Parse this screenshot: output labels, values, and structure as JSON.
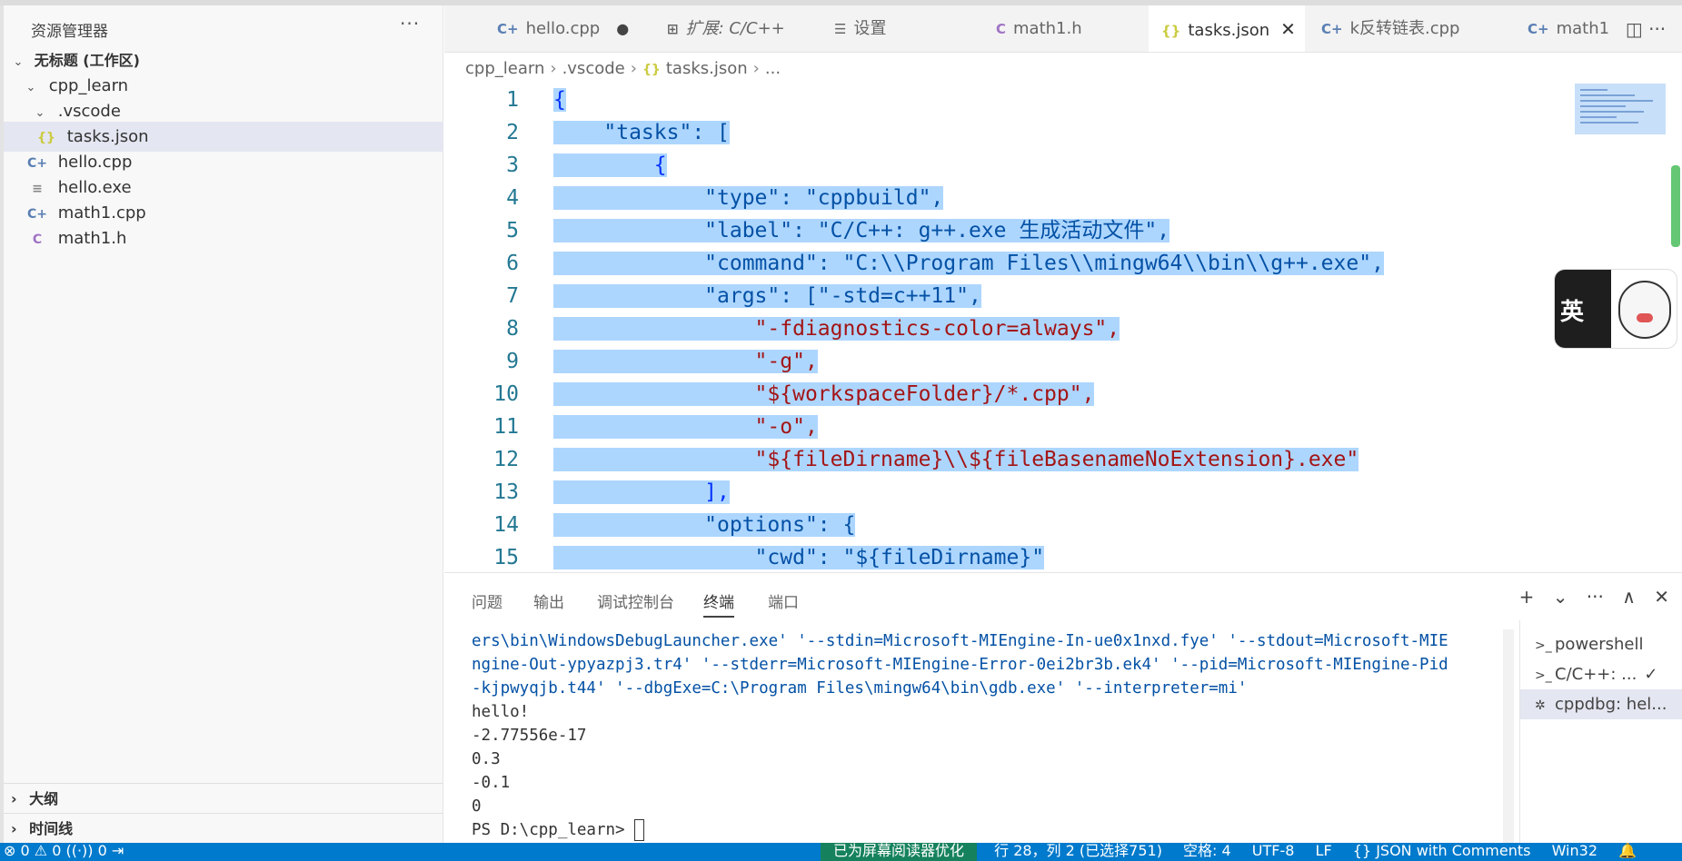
{
  "explorer": {
    "title": "资源管理器",
    "more": "···",
    "workspace": "无标题 (工作区)",
    "folder": "cpp_learn",
    "subfolder": ".vscode",
    "files": [
      {
        "name": "tasks.json",
        "icon": "json-icon",
        "glyph": "{}"
      },
      {
        "name": "hello.cpp",
        "icon": "cpp-file-icon",
        "glyph": "C+"
      },
      {
        "name": "hello.exe",
        "icon": "exe-file-icon",
        "glyph": "≡"
      },
      {
        "name": "math1.cpp",
        "icon": "cpp-file-icon",
        "glyph": "C+"
      },
      {
        "name": "math1.h",
        "icon": "c-header-icon",
        "glyph": "C"
      }
    ],
    "outline": "大纲",
    "timeline": "时间线"
  },
  "tabs": [
    {
      "label": "hello.cpp",
      "glyph": "C+",
      "modified": "●"
    },
    {
      "label": "扩展: C/C++",
      "glyph": "⊞"
    },
    {
      "label": "设置",
      "glyph": "☰"
    },
    {
      "label": "math1.h",
      "glyph": "C"
    },
    {
      "label": "tasks.json",
      "glyph": "{}",
      "close": "✕"
    },
    {
      "label": "k反转链表.cpp",
      "glyph": "C+"
    },
    {
      "label": "math1",
      "glyph": "C+"
    }
  ],
  "tab_actions": "◫ ···",
  "breadcrumb": [
    "cpp_learn",
    ".vscode",
    "tasks.json",
    "..."
  ],
  "editor": {
    "line_numbers": [
      "1",
      "2",
      "3",
      "4",
      "5",
      "6",
      "7",
      "8",
      "9",
      "10",
      "11",
      "12",
      "13",
      "14",
      "15"
    ],
    "lines": [
      "{",
      "    \"tasks\": [",
      "        {",
      "            \"type\": \"cppbuild\",",
      "            \"label\": \"C/C++: g++.exe 生成活动文件\",",
      "            \"command\": \"C:\\\\Program Files\\\\mingw64\\\\bin\\\\g++.exe\",",
      "            \"args\": [\"-std=c++11\",",
      "                \"-fdiagnostics-color=always\",",
      "                \"-g\",",
      "                \"${workspaceFolder}/*.cpp\",",
      "                \"-o\",",
      "                \"${fileDirname}\\\\${fileBasenameNoExtension}.exe\"",
      "            ],",
      "            \"options\": {",
      "                \"cwd\": \"${fileDirname}\""
    ]
  },
  "ime": {
    "label": "英"
  },
  "panel": {
    "tabs": [
      "问题",
      "输出",
      "调试控制台",
      "终端",
      "端口"
    ],
    "actions": "+ ⌄ ··· ∧ ✕",
    "terminal_lines": [
      "ers\\bin\\WindowsDebugLauncher.exe' '--stdin=Microsoft-MIEngine-In-ue0x1nxd.fye' '--stdout=Microsoft-MIE",
      "ngine-Out-ypyazpj3.tr4' '--stderr=Microsoft-MIEngine-Error-0ei2br3b.ek4' '--pid=Microsoft-MIEngine-Pid",
      "-kjpwyqjb.t44' '--dbgExe=C:\\Program Files\\mingw64\\bin\\gdb.exe' '--interpreter=mi'",
      "hello!",
      "-2.77556e-17",
      "0.3",
      "-0.1",
      "0"
    ],
    "prompt": "PS D:\\cpp_learn> ",
    "terminals": [
      {
        "label": "powershell",
        "glyph": ">_"
      },
      {
        "label": "C/C++: ...",
        "glyph": ">_",
        "check": "✓"
      },
      {
        "label": "cppdbg: hel...",
        "glyph": "✲"
      }
    ]
  },
  "statusbar": {
    "left": "⊗ 0 ⚠ 0   ((·)) 0   ⇥",
    "reader": "已为屏幕阅读器优化",
    "position": "行 28，列 2 (已选择751)",
    "spaces": "空格: 4",
    "encoding": "UTF-8",
    "eol": "LF",
    "language": "{} JSON with Comments",
    "platform": "Win32",
    "bell": "🔔"
  }
}
